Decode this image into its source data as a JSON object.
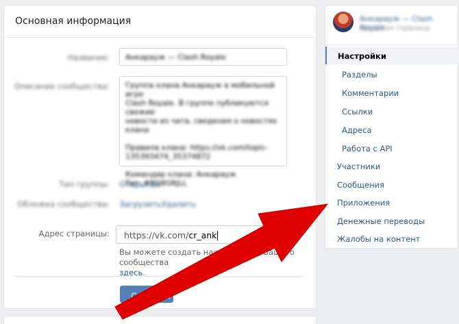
{
  "main": {
    "title": "Основная информация",
    "name_label": "Название:",
    "name_value": "Анкарауж — Clash Royale",
    "description_label": "Описание сообщества:",
    "description_lines": [
      "Группа клана Анкарауж в мобильной игре",
      "Clash Royale. В группе публикуются свежие",
      "новости из чата, сведения о новостях клана"
    ],
    "description_extra": [
      "Правила клана: https://vk.com/topic-",
      "135393474_35374872",
      "Командир клана: Анкарауж",
      "Тег: #8G8GRJLL"
    ],
    "group_type_label": "Тип группы:",
    "group_type_value": "Открытая",
    "cover_label": "Обложка сообщества:",
    "cover_upload": "Загрузить",
    "cover_delete": "Удалить",
    "address_label": "Адрес страницы:",
    "address_prefix": "https://vk.com/",
    "address_value": "cr_ank",
    "hint_text": "Вы можете создать наклейки для Вашего сообщества",
    "hint_link": "здесь",
    "hint_dot": ".",
    "save_label": "Сохранить"
  },
  "sidebar": {
    "group_name": "Анкарауж — Clash Royale",
    "group_sub": "закрытая страница",
    "active_item": "Настройки",
    "sub_items": [
      "Разделы",
      "Комментарии",
      "Ссылки",
      "Адреса",
      "Работа с API"
    ],
    "items": [
      "Участники",
      "Сообщения",
      "Приложения",
      "Денежные переводы",
      "Жалобы на контент"
    ]
  },
  "colors": {
    "accent": "#5181b8",
    "link": "#2a5885",
    "arrow": "#e00000",
    "background": "#edeef0"
  },
  "icons": {
    "avatar": "group-avatar-icon",
    "arrow": "red-arrow-icon"
  }
}
